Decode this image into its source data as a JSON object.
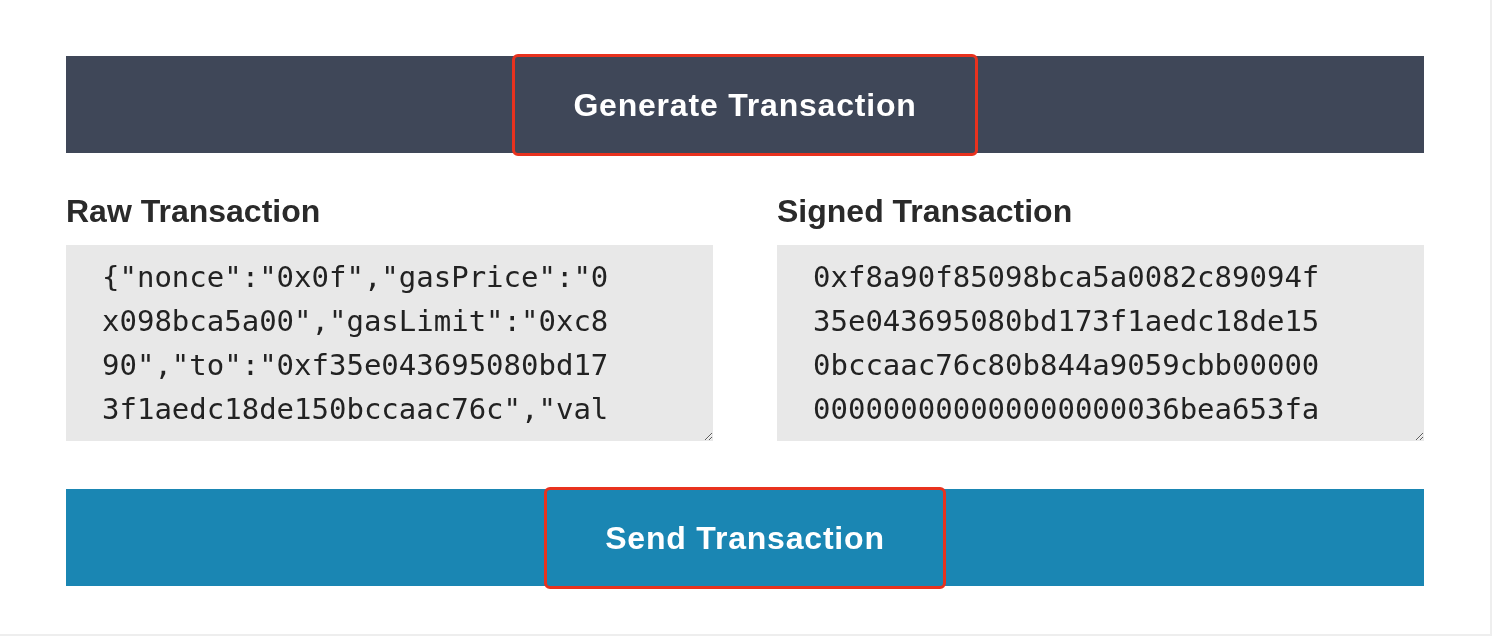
{
  "generate_button": {
    "label": "Generate Transaction",
    "highlighted": true
  },
  "raw_transaction": {
    "heading": "Raw Transaction",
    "lines": [
      "{\"nonce\":\"0x0f\",\"gasPrice\":\"0",
      "x098bca5a00\",\"gasLimit\":\"0xc8",
      "90\",\"to\":\"0xf35e043695080bd17",
      "3f1aedc18de150bccaac76c\",\"val"
    ]
  },
  "signed_transaction": {
    "heading": "Signed Transaction",
    "lines": [
      "0xf8a90f85098bca5a0082c89094f",
      "35e043695080bd173f1aedc18de15",
      "0bccaac76c80b844a9059cbb00000",
      "000000000000000000036bea653fa"
    ]
  },
  "send_button": {
    "label": "Send Transaction",
    "highlighted": true
  }
}
